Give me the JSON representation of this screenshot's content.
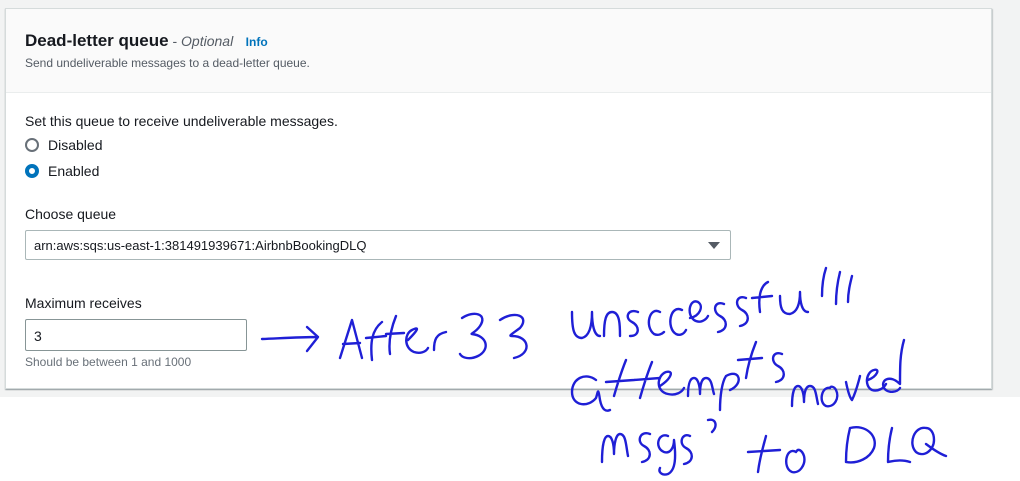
{
  "dlq": {
    "title": "Dead-letter queue",
    "title_separator": " - ",
    "optional_label": "Optional",
    "info_link": "Info",
    "description": "Send undeliverable messages to a dead-letter queue.",
    "set_label": "Set this queue to receive undeliverable messages.",
    "options": [
      {
        "label": "Disabled",
        "selected": false
      },
      {
        "label": "Enabled",
        "selected": true
      }
    ],
    "choose_queue_label": "Choose queue",
    "queue_value": "arn:aws:sqs:us-east-1:381491939671:AirbnbBookingDLQ",
    "max_receives_label": "Maximum receives",
    "max_receives_value": "3",
    "max_receives_hint": "Should be between 1 and 1000"
  },
  "annotation": {
    "handwritten_text": "→ After 3 unsuccessful attempts msgs moved to DLQ",
    "ink_color": "#1f1fd6"
  },
  "colors": {
    "accent": "#0073bb",
    "page_background": "#f2f3f3"
  }
}
